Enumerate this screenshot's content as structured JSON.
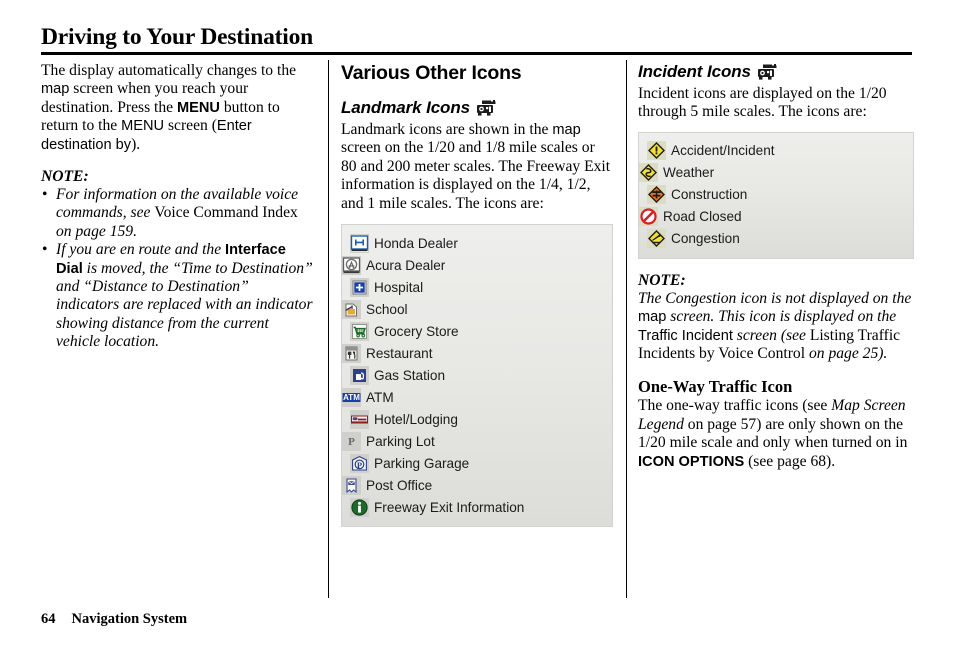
{
  "header": {
    "title": "Driving to Your Destination"
  },
  "footer": {
    "page_number": "64",
    "section_name": "Navigation System"
  },
  "column1": {
    "intro": {
      "s1": "The display automatically changes to the ",
      "s2_sans": "map",
      "s3": " screen when you reach your destination. Press the ",
      "s4_sans_bold": "MENU",
      "s5": " button to return to the ",
      "s6_sans": "MENU",
      "s7": " screen (",
      "s8_sans": "Enter destination by",
      "s9": ")."
    },
    "note_label": "NOTE:",
    "notes": [
      {
        "bullet": "•",
        "p1_italic": "For information on the available voice commands, see ",
        "p2_upright": "Voice Command Index",
        "p3_italic": " on page 159."
      },
      {
        "bullet": "•",
        "p1_italic": "If you are en route and the ",
        "p2_sans_bold": "Interface Dial",
        "p3_italic": " is moved, the “Time to Destination” and “Distance to Destination” indicators are replaced with an indicator showing distance from the current vehicle location."
      }
    ]
  },
  "column2": {
    "heading": "Various Other Icons",
    "subheading": {
      "label": "Landmark Icons",
      "icon": "traffic-camera-icon"
    },
    "paragraph": {
      "s1": "Landmark icons are shown in the ",
      "s2_sans": "map",
      "s3": " screen on the 1/20 and 1/8 mile scales or 80 and 200 meter scales. The Freeway Exit information is displayed on the 1/4, 1/2, and 1 mile scales. The icons are:"
    },
    "landmark_icons": {
      "left_column": [
        {
          "label": "Honda Dealer",
          "icon": "honda-dealer-icon"
        },
        {
          "label": "Hospital",
          "icon": "hospital-icon"
        },
        {
          "label": "Grocery Store",
          "icon": "grocery-store-icon"
        },
        {
          "label": "Gas Station",
          "icon": "gas-station-icon"
        },
        {
          "label": "Hotel/Lodging",
          "icon": "hotel-lodging-icon"
        },
        {
          "label": "Parking Garage",
          "icon": "parking-garage-icon"
        },
        {
          "label": "Freeway Exit Information",
          "icon": "freeway-exit-information-icon"
        }
      ],
      "right_column": [
        {
          "label": "Acura Dealer",
          "icon": "acura-dealer-icon"
        },
        {
          "label": "School",
          "icon": "school-icon"
        },
        {
          "label": "Restaurant",
          "icon": "restaurant-icon"
        },
        {
          "label": "ATM",
          "icon": "atm-icon"
        },
        {
          "label": "Parking Lot",
          "icon": "parking-lot-icon"
        },
        {
          "label": "Post Office",
          "icon": "post-office-icon"
        }
      ]
    }
  },
  "column3": {
    "subheading": {
      "label": "Incident Icons",
      "icon": "traffic-camera-icon"
    },
    "paragraph": "Incident icons are displayed on the 1/20 through 5 mile scales. The icons are:",
    "incident_icons": {
      "left_column": [
        {
          "label": "Accident/Incident",
          "icon": "accident-incident-icon"
        },
        {
          "label": "Construction",
          "icon": "construction-icon"
        },
        {
          "label": "Congestion",
          "icon": "congestion-icon"
        }
      ],
      "right_column": [
        {
          "label": "Weather",
          "icon": "weather-icon"
        },
        {
          "label": "Road Closed",
          "icon": "road-closed-icon"
        }
      ]
    },
    "note_label": "NOTE:",
    "note": {
      "s1_italic": "The Congestion icon is not displayed on the ",
      "s2_sans": "map",
      "s3_italic": " screen. This icon is displayed on the ",
      "s4_sans": "Traffic Incident",
      "s5_italic": " screen (see ",
      "s6_upright": "Listing Traffic Incidents by Voice Control",
      "s7_italic": " on page 25)."
    },
    "oneway_heading": "One-Way Traffic Icon",
    "oneway_text": {
      "s1": "The one-way traffic icons (see ",
      "s2_italic": "Map Screen Legend",
      "s3": " on page 57) are only shown on the 1/20 mile scale and only when turned on in ",
      "s4_sans_bold": "ICON OPTIONS",
      "s5": " (see page 68)."
    }
  },
  "colors": {
    "page_bg": "#ffffff",
    "text": "#000000",
    "box_bg": "#e8e8e5",
    "box_border": "#d2d2ce",
    "tile_bg": "#cfcfcb",
    "tile_yellow_bg": "#dcdcc0",
    "honda_blue": "#1a5fa8",
    "incident_yellow": "#f2e03a",
    "construction_orange": "#e8761e",
    "road_closed_red": "#d81f26",
    "freeway_green": "#1d6b2a"
  }
}
